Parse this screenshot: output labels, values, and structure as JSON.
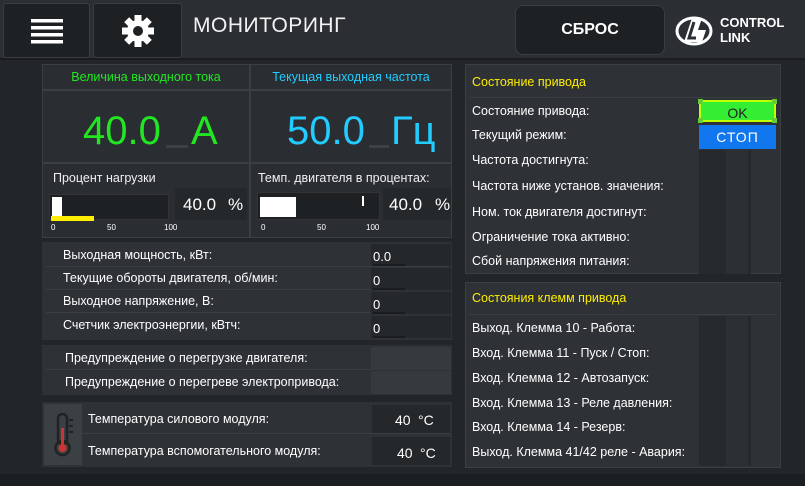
{
  "header": {
    "menu_icon": "hamburger-menu-icon",
    "settings_icon": "gear-icon",
    "title": "МОНИТОРИНГ",
    "reset_label": "СБРОС",
    "logo_text_line1": "CONTROL",
    "logo_text_line2": "LINK"
  },
  "current": {
    "label": "Величина выходного тока",
    "value": "40.0",
    "unit": "A",
    "color": "#22e622"
  },
  "frequency": {
    "label": "Текущая выходная частота",
    "value": "50.0",
    "unit": "Гц",
    "color": "#22ccff"
  },
  "load": {
    "label": "Процент нагрузки",
    "value": "40.0",
    "unit": "%",
    "level_percent": 40,
    "ticks": [
      "0",
      "50",
      "100"
    ]
  },
  "motor_temp": {
    "label": "Темп. двигателя в процентах:",
    "value": "40.0",
    "unit": "%",
    "level_percent": 40,
    "ticks": [
      "0",
      "50",
      "100"
    ]
  },
  "measurements": [
    {
      "label": "Выходная мощность, кВт:",
      "value": "0.0"
    },
    {
      "label": "Текущие обороты двигателя, об/мин:",
      "value": "0"
    },
    {
      "label": "Выходное напряжение, В:",
      "value": "0"
    },
    {
      "label": "Счетчик электроэнергии, кВтч:",
      "value": "0"
    }
  ],
  "warnings": [
    {
      "label": "Предупреждение о перегрузке двигателя:"
    },
    {
      "label": "Предупреждение о перегреве электропривода:"
    }
  ],
  "temperatures": {
    "icon": "thermometer-icon",
    "rows": [
      {
        "label": "Температура силового модуля:",
        "value": "40",
        "unit": "°C"
      },
      {
        "label": "Температура вспомогательного модуля:",
        "value": "40",
        "unit": "°C"
      }
    ]
  },
  "drive_state": {
    "title": "Состояние привода",
    "title_color": "#ffee00",
    "rows": [
      {
        "label": "Состояние привода:",
        "status": "OK",
        "status_color": "#33ee33"
      },
      {
        "label": "Текущий режим:",
        "status": "СТОП",
        "status_color": "#1177ee"
      },
      {
        "label": "Частота достигнута:"
      },
      {
        "label": "Частота ниже установ. значения:"
      },
      {
        "label": "Ном. ток двигателя достигнут:"
      },
      {
        "label": "Ограничение тока активно:"
      },
      {
        "label": "Сбой напряжения питания:"
      }
    ]
  },
  "terminals": {
    "title": "Состояния клемм привода",
    "rows": [
      {
        "label": "Выход. Клемма 10 - Работа:"
      },
      {
        "label": "Вход. Клемма 11 -  Пуск / Стоп:"
      },
      {
        "label": "Вход. Клемма 12  - Автозапуск:"
      },
      {
        "label": "Вход. Клемма 13 - Реле давления:"
      },
      {
        "label": "Вход. Клемма 14  - Резерв:"
      },
      {
        "label": "Выход. Клемма 41/42 реле  - Авария:"
      }
    ]
  }
}
